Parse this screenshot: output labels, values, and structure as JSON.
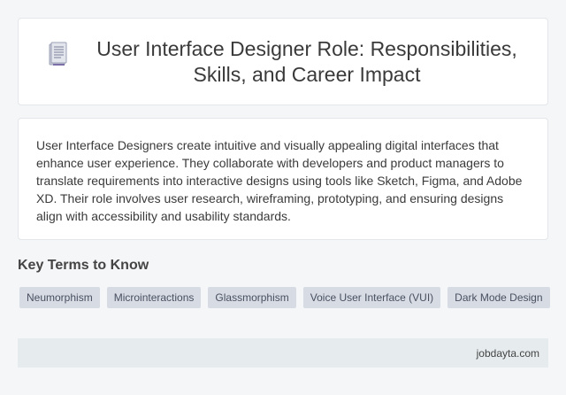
{
  "header": {
    "icon": "document-icon",
    "title": "User Interface Designer Role: Responsibilities, Skills, and Career Impact"
  },
  "description": {
    "text": "User Interface Designers create intuitive and visually appealing digital interfaces that enhance user experience. They collaborate with developers and product managers to translate requirements into interactive designs using tools like Sketch, Figma, and Adobe XD. Their role involves user research, wireframing, prototyping, and ensuring designs align with accessibility and usability standards."
  },
  "key_terms": {
    "heading": "Key Terms to Know",
    "tags": [
      "Neumorphism",
      "Microinteractions",
      "Glassmorphism",
      "Voice User Interface (VUI)",
      "Dark Mode Design"
    ]
  },
  "footer": {
    "site": "jobdayta.com"
  },
  "colors": {
    "background": "#f5f6f8",
    "card": "#ffffff",
    "tag_bg": "#d6dbe4",
    "footer_bg": "#e6ebee"
  }
}
